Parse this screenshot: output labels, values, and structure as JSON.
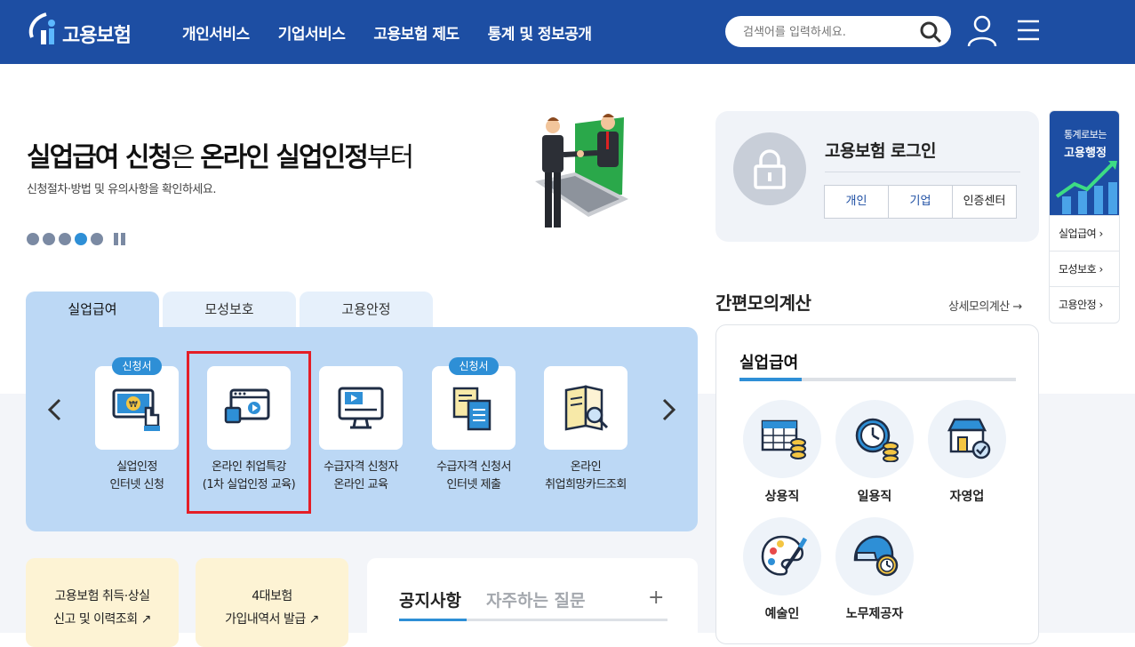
{
  "header": {
    "logo_text": "고용보험",
    "nav": [
      "개인서비스",
      "기업서비스",
      "고용보험 제도",
      "통계 및 정보공개"
    ],
    "search_placeholder": "검색어를 입력하세요."
  },
  "banner": {
    "title_bold1": "실업급여 신청",
    "title_light1": "은 ",
    "title_bold2": "온라인 실업인정",
    "title_light2": "부터",
    "subtitle": "신청절차·방법 및 유의사항을 확인하세요.",
    "slide_count": 5,
    "active_slide": 4
  },
  "tabs": [
    "실업급여",
    "모성보호",
    "고용안정"
  ],
  "services": [
    {
      "label": "실업인정\n인터넷 신청",
      "badge": "신청서"
    },
    {
      "label": "온라인 취업특강\n(1차 실업인정 교육)",
      "badge": ""
    },
    {
      "label": "수급자격 신청자\n온라인 교육",
      "badge": ""
    },
    {
      "label": "수급자격 신청서\n인터넷 제출",
      "badge": "신청서"
    },
    {
      "label": "온라인\n취업희망카드조회",
      "badge": ""
    }
  ],
  "login": {
    "title": "고용보험 로그인",
    "buttons": [
      "개인",
      "기업",
      "인증센터"
    ]
  },
  "sidebar": {
    "line1": "통계로보는",
    "line2": "고용행정",
    "items": [
      "실업급여 ›",
      "모성보호 ›",
      "고용안정 ›"
    ]
  },
  "calc": {
    "title": "간편모의계산",
    "more": "상세모의계산 →",
    "sub": "실업급여",
    "items": [
      "상용직",
      "일용직",
      "자영업",
      "예술인",
      "노무제공자"
    ]
  },
  "cards": [
    {
      "line1": "고용보험 취득·상실",
      "line2": "신고 및 이력조회 ↗"
    },
    {
      "line1": "4대보험",
      "line2": "가입내역서 발급 ↗"
    }
  ],
  "notice": {
    "tab1": "공지사항",
    "tab2": "자주하는 질문",
    "plus": "+"
  },
  "colors": {
    "brand": "#1d4ea3",
    "accent": "#2e8fd6",
    "highlight": "#e41e26"
  }
}
